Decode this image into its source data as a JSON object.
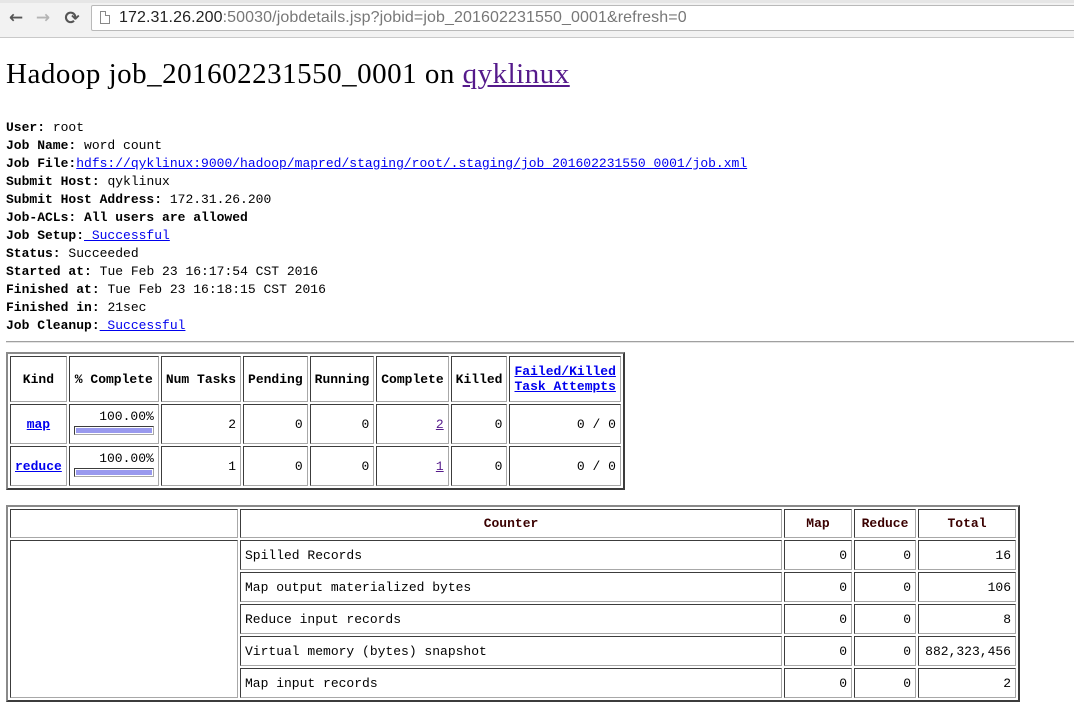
{
  "browser": {
    "url_host": "172.31.26.200",
    "url_rest": ":50030/jobdetails.jsp?jobid=job_201602231550_0001&refresh=0",
    "back_icon": "←",
    "forward_icon": "→",
    "reload_icon": "⟳"
  },
  "title": {
    "prefix": "Hadoop job_201602231550_0001 on ",
    "host_link": "qyklinux"
  },
  "info": [
    {
      "label": "User:",
      "value": "root",
      "link": false
    },
    {
      "label": "Job Name:",
      "value": "word count",
      "link": false
    },
    {
      "label": "Job File:",
      "value": "hdfs://qyklinux:9000/hadoop/mapred/staging/root/.staging/job_201602231550_0001/job.xml",
      "link": true
    },
    {
      "label": "Submit Host:",
      "value": "qyklinux",
      "link": false
    },
    {
      "label": "Submit Host Address:",
      "value": "172.31.26.200",
      "link": false
    },
    {
      "label": "Job-ACLs: All users are allowed",
      "value": "",
      "link": false
    },
    {
      "label": "Job Setup:",
      "value": " Successful",
      "link": true
    },
    {
      "label": "Status:",
      "value": "Succeeded",
      "link": false
    },
    {
      "label": "Started at:",
      "value": "Tue Feb 23 16:17:54 CST 2016",
      "link": false
    },
    {
      "label": "Finished at:",
      "value": "Tue Feb 23 16:18:15 CST 2016",
      "link": false
    },
    {
      "label": "Finished in:",
      "value": "21sec",
      "link": false
    },
    {
      "label": "Job Cleanup:",
      "value": " Successful",
      "link": true
    }
  ],
  "task_table": {
    "headers": [
      "Kind",
      "% Complete",
      "Num Tasks",
      "Pending",
      "Running",
      "Complete",
      "Killed"
    ],
    "failed_header_line1": "Failed/Killed",
    "failed_header_line2": "Task Attempts",
    "rows": [
      {
        "kind": "map",
        "pct": "100.00%",
        "progress": 1.0,
        "num_tasks": "2",
        "pending": "0",
        "running": "0",
        "complete": "2",
        "killed": "0",
        "failed_killed": "0 / 0"
      },
      {
        "kind": "reduce",
        "pct": "100.00%",
        "progress": 1.0,
        "num_tasks": "1",
        "pending": "0",
        "running": "0",
        "complete": "1",
        "killed": "0",
        "failed_killed": "0 / 0"
      }
    ]
  },
  "counter_table": {
    "headers": [
      "",
      "Counter",
      "Map",
      "Reduce",
      "Total"
    ],
    "rows": [
      {
        "name": "Spilled Records",
        "map": "0",
        "reduce": "0",
        "total": "16"
      },
      {
        "name": "Map output materialized bytes",
        "map": "0",
        "reduce": "0",
        "total": "106"
      },
      {
        "name": "Reduce input records",
        "map": "0",
        "reduce": "0",
        "total": "8"
      },
      {
        "name": "Virtual memory (bytes) snapshot",
        "map": "0",
        "reduce": "0",
        "total": "882,323,456"
      },
      {
        "name": "Map input records",
        "map": "0",
        "reduce": "0",
        "total": "2"
      }
    ]
  }
}
